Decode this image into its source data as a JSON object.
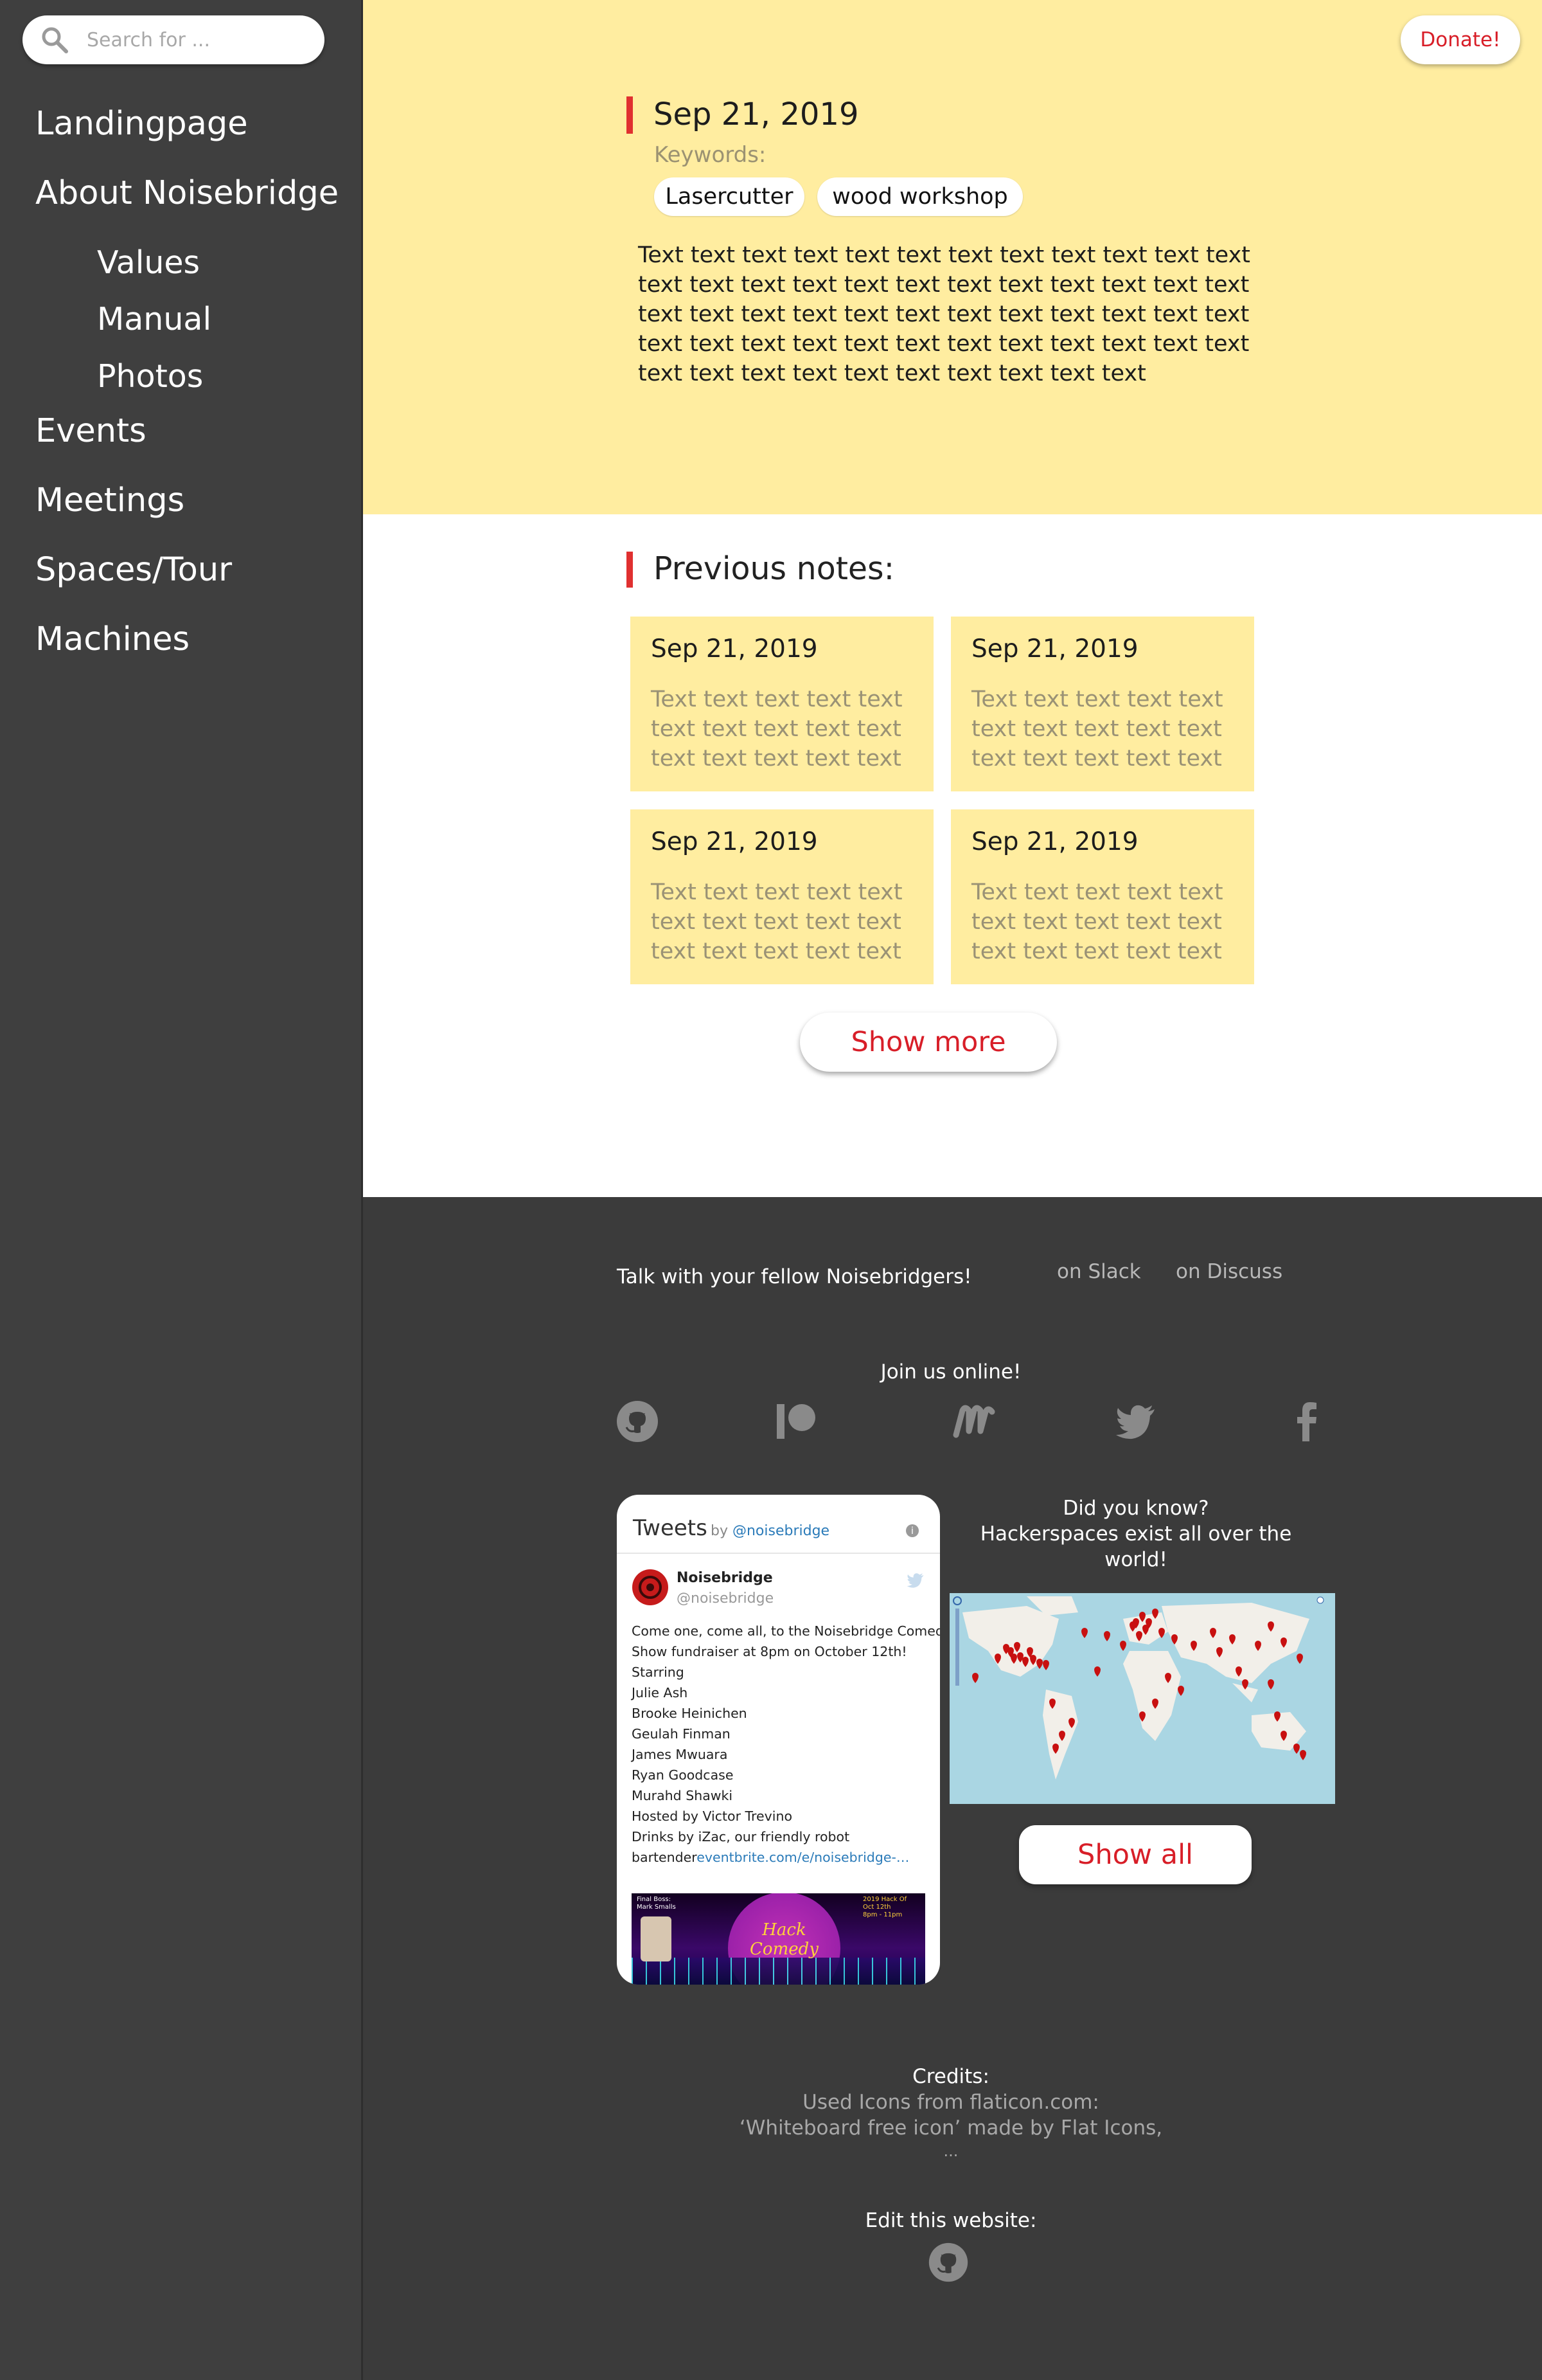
{
  "search": {
    "placeholder": "Search for ..."
  },
  "sidebar": {
    "items": [
      {
        "label": "Landingpage"
      },
      {
        "label": "About Noisebridge"
      },
      {
        "label": "Values"
      },
      {
        "label": "Manual"
      },
      {
        "label": "Photos"
      },
      {
        "label": "Events"
      },
      {
        "label": "Meetings"
      },
      {
        "label": "Spaces/Tour"
      },
      {
        "label": "Machines"
      }
    ]
  },
  "header": {
    "donate_label": "Donate!"
  },
  "entry": {
    "date": "Sep 21, 2019",
    "keywords_label": "Keywords:",
    "tags": [
      "Lasercutter",
      "wood workshop"
    ],
    "text": "Text text text text text text text text text text text text text text text text text text text text text text text text text text text text text text text text text text text text text text text text text text text text text text text text text text text text text text text text text text"
  },
  "previous": {
    "title": "Previous notes:",
    "notes": [
      {
        "date": "Sep 21, 2019",
        "text": "Text text text text text text text text text text text text text text text"
      },
      {
        "date": "Sep 21, 2019",
        "text": "Text text text text text text text text text text text text text text text"
      },
      {
        "date": "Sep 21, 2019",
        "text": "Text text text text text text text text text text text text text text text"
      },
      {
        "date": "Sep 21, 2019",
        "text": "Text text text text text text text text text text text text text text text"
      }
    ],
    "show_more_label": "Show more"
  },
  "footer": {
    "talk_label": "Talk with your fellow Noisebridgers!",
    "slack_label": "on Slack",
    "discuss_label": "on Discuss",
    "join_label": "Join us online!",
    "social_icons": [
      "github-icon",
      "patreon-icon",
      "meetup-icon",
      "twitter-icon",
      "facebook-icon"
    ],
    "tweets": {
      "title": "Tweets",
      "by": "by",
      "handle_link": "@noisebridge",
      "name": "Noisebridge",
      "handle": "@noisebridge",
      "lines": [
        "Come one, come all, to the Noisebridge Comedy",
        "Show fundraiser at 8pm on October 12th!",
        "Starring",
        "Julie Ash",
        "Brooke Heinichen",
        "Geulah Finman",
        "James Mwuara",
        "Ryan Goodcase",
        "Murahd Shawki",
        "Hosted by Victor Trevino",
        "Drinks by iZac, our friendly robot"
      ],
      "last_line_prefix": "bartender",
      "last_line_link": "eventbrite.com/e/noisebridge-…",
      "image_title": "Hack Comedy",
      "image_top_left": "Final Boss:\nMark Smalls",
      "image_top_right": "2019 Hack Of\nOct 12th\n8pm - 11pm"
    },
    "did_you_know": [
      "Did you know?",
      "Hackerspaces exist all over the",
      "world!"
    ],
    "show_all_label": "Show all",
    "credits_title": "Credits:",
    "credits_lines": [
      "Used Icons from flaticon.com:",
      "‘Whiteboard free icon’ made by Flat Icons,",
      "..."
    ],
    "edit_label": "Edit this website:"
  },
  "colors": {
    "accent": "#d81e28",
    "hero_bg": "#ffeda0",
    "sidebar_bg": "#3f3f3f",
    "footer_bg": "#3b3b3b"
  }
}
